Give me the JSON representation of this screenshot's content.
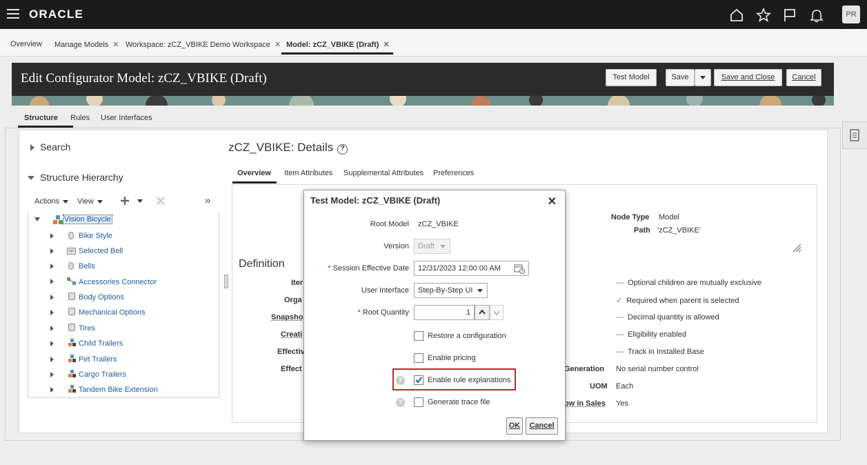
{
  "header": {
    "logo": "ORACLE",
    "avatar": "PR",
    "icons": [
      "home-icon",
      "favorites-star-icon",
      "flag-icon",
      "bell-icon"
    ]
  },
  "tabs": [
    {
      "label": "Overview",
      "closable": false
    },
    {
      "label": "Manage Models",
      "closable": true
    },
    {
      "label": "Workspace: zCZ_VBIKE Demo Workspace",
      "closable": true
    },
    {
      "label": "Model: zCZ_VBIKE (Draft)",
      "closable": true,
      "active": true
    }
  ],
  "close_glyph": "✕",
  "page": {
    "title": "Edit Configurator Model: zCZ_VBIKE (Draft)",
    "buttons": {
      "test_model": "Test Model",
      "save": "Save",
      "save_and_close": "Save and Close",
      "cancel": "Cancel"
    },
    "subtabs": [
      "Structure",
      "Rules",
      "User Interfaces"
    ]
  },
  "left": {
    "search": "Search",
    "hierarchy": "Structure Hierarchy",
    "actions": "Actions",
    "view": "View",
    "more": "»",
    "tree": [
      "Vision Bicycle",
      "Bike Style",
      "Selected Bell",
      "Bells",
      "Accessories Connector",
      "Body Options",
      "Mechanical Options",
      "Tires",
      "Child Trailers",
      "Pet Trailers",
      "Cargo Trailers",
      "Tandem Bike Extension"
    ]
  },
  "details": {
    "title": "zCZ_VBIKE: Details",
    "tabs": [
      "Overview",
      "Item Attributes",
      "Supplemental Attributes",
      "Preferences"
    ],
    "node_type_label": "Node Type",
    "node_type": "Model",
    "path_label": "Path",
    "path": "'zCZ_VBIKE'",
    "definition": "Definition",
    "left_labels": [
      "Iter",
      "Orga",
      "Snapsho",
      "Creati",
      "Effectiv",
      "Effect"
    ],
    "flags": [
      {
        "label": "Optional children are mutually exclusive",
        "checked": false
      },
      {
        "label": "Required when parent is selected",
        "checked": true
      },
      {
        "label": "Decimal quantity is allowed",
        "checked": false
      },
      {
        "label": "Eligibility enabled",
        "checked": false
      },
      {
        "label": "Track in Installed Base",
        "checked": false
      }
    ],
    "generation_label": "Generation",
    "generation": "No serial number control",
    "uom_label": "UOM",
    "uom": "Each",
    "sales_label": "ow in Sales",
    "sales": "Yes",
    "dash": "—",
    "check": "✓"
  },
  "modal": {
    "title": "Test Model: zCZ_VBIKE (Draft)",
    "close": "✕",
    "root_model_label": "Root Model",
    "root_model": "zCZ_VBIKE",
    "version_label": "Version",
    "version": "Draft",
    "session_date_label": "Session Effective Date",
    "session_date": "12/31/2023 12:00:00 AM",
    "ui_label": "User Interface",
    "ui": "Step-By-Step UI",
    "root_qty_label": "Root Quantity",
    "root_qty": "1",
    "required_mark": "*",
    "options": [
      {
        "label": "Restore a configuration",
        "checked": false,
        "hint": false
      },
      {
        "label": "Enable pricing",
        "checked": false,
        "hint": false
      },
      {
        "label": "Enable rule explanations",
        "checked": true,
        "hint": true
      },
      {
        "label": "Generate trace file",
        "checked": false,
        "hint": true
      }
    ],
    "hint_glyph": "?",
    "ok": "OK",
    "cancel": "Cancel"
  }
}
